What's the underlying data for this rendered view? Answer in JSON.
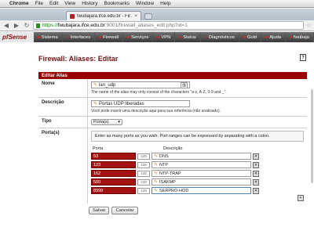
{
  "menubar": {
    "app": "Chrome",
    "items": [
      "File",
      "Edit",
      "View",
      "History",
      "Bookmarks",
      "Window",
      "Help"
    ]
  },
  "browser": {
    "tab_title": "fwubajara.ifce.edu.br - Fir…",
    "url_scheme": "https://",
    "url_host": "fwubajara.ifce.edu.br",
    "url_path": ":9001/firewall_aliases_edit.php?id=1"
  },
  "nav": {
    "logo_pf": "pf",
    "logo_sense": "Sense",
    "items": [
      "Sistema",
      "Interfaces",
      "Firewall",
      "Serviços",
      "VPN",
      "Status",
      "Diagnósticos",
      "Gold",
      "Ajuda"
    ],
    "host_right": "fwubaja"
  },
  "page": {
    "title": "Firewall: Aliases: Editar",
    "help": "?"
  },
  "form": {
    "section": "Editar Alias",
    "name_label": "Nome",
    "name_value": "lan_udp",
    "name_hint": "The name of the alias may only consist of the characters \"a-z, A-Z, 0-9 and _\".",
    "desc_label": "Descrição",
    "desc_value": "Portas UDP liberadas",
    "desc_hint": "Você pode inserir uma descrição aqui para sua referência (não analisado).",
    "type_label": "Tipo",
    "type_value": "Porta(s)",
    "ports_label": "Porta(s)",
    "ports_info": "Enter as many ports as you wish. Port ranges can be expressed by separating with a colon.",
    "col_port": "Porta",
    "col_desc": "Descrição",
    "rows": [
      {
        "port": "53",
        "mini": "128",
        "desc": "DNS"
      },
      {
        "port": "123",
        "mini": "128",
        "desc": "NTP"
      },
      {
        "port": "162",
        "mini": "128",
        "desc": "NTP-TRAP"
      },
      {
        "port": "500",
        "mini": "128",
        "desc": "ISAKMP"
      },
      {
        "port": "8999",
        "mini": "128",
        "desc": "SERPRO-HOD"
      }
    ],
    "save": "Salvar",
    "cancel": "Cancelar"
  }
}
